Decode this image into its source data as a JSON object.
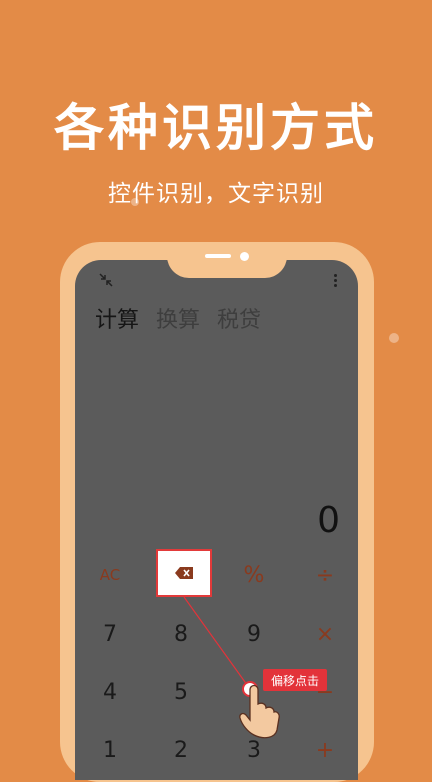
{
  "headline": "各种识别方式",
  "subline": "控件识别，文字识别",
  "phone": {
    "tabs": [
      {
        "label": "计算",
        "active": true
      },
      {
        "label": "换算",
        "active": false
      },
      {
        "label": "税贷",
        "active": false
      }
    ],
    "display_value": "0",
    "keys": {
      "ac": "AC",
      "percent": "%",
      "divide": "÷",
      "seven": "7",
      "eight": "8",
      "nine": "9",
      "multiply": "×",
      "four": "4",
      "five": "5",
      "minus": "−",
      "one": "1",
      "two": "2",
      "three": "3",
      "plus": "+"
    },
    "tooltip": "偏移点击"
  },
  "colors": {
    "background": "#E38B47",
    "phone_frame": "#F6C48F",
    "screen": "#5B5B5B",
    "accent_red": "#E3333A",
    "operator": "#8A3A1E"
  },
  "icons": [
    "shrink-icon",
    "more-vert-icon",
    "backspace-icon",
    "hand-pointer-icon"
  ]
}
